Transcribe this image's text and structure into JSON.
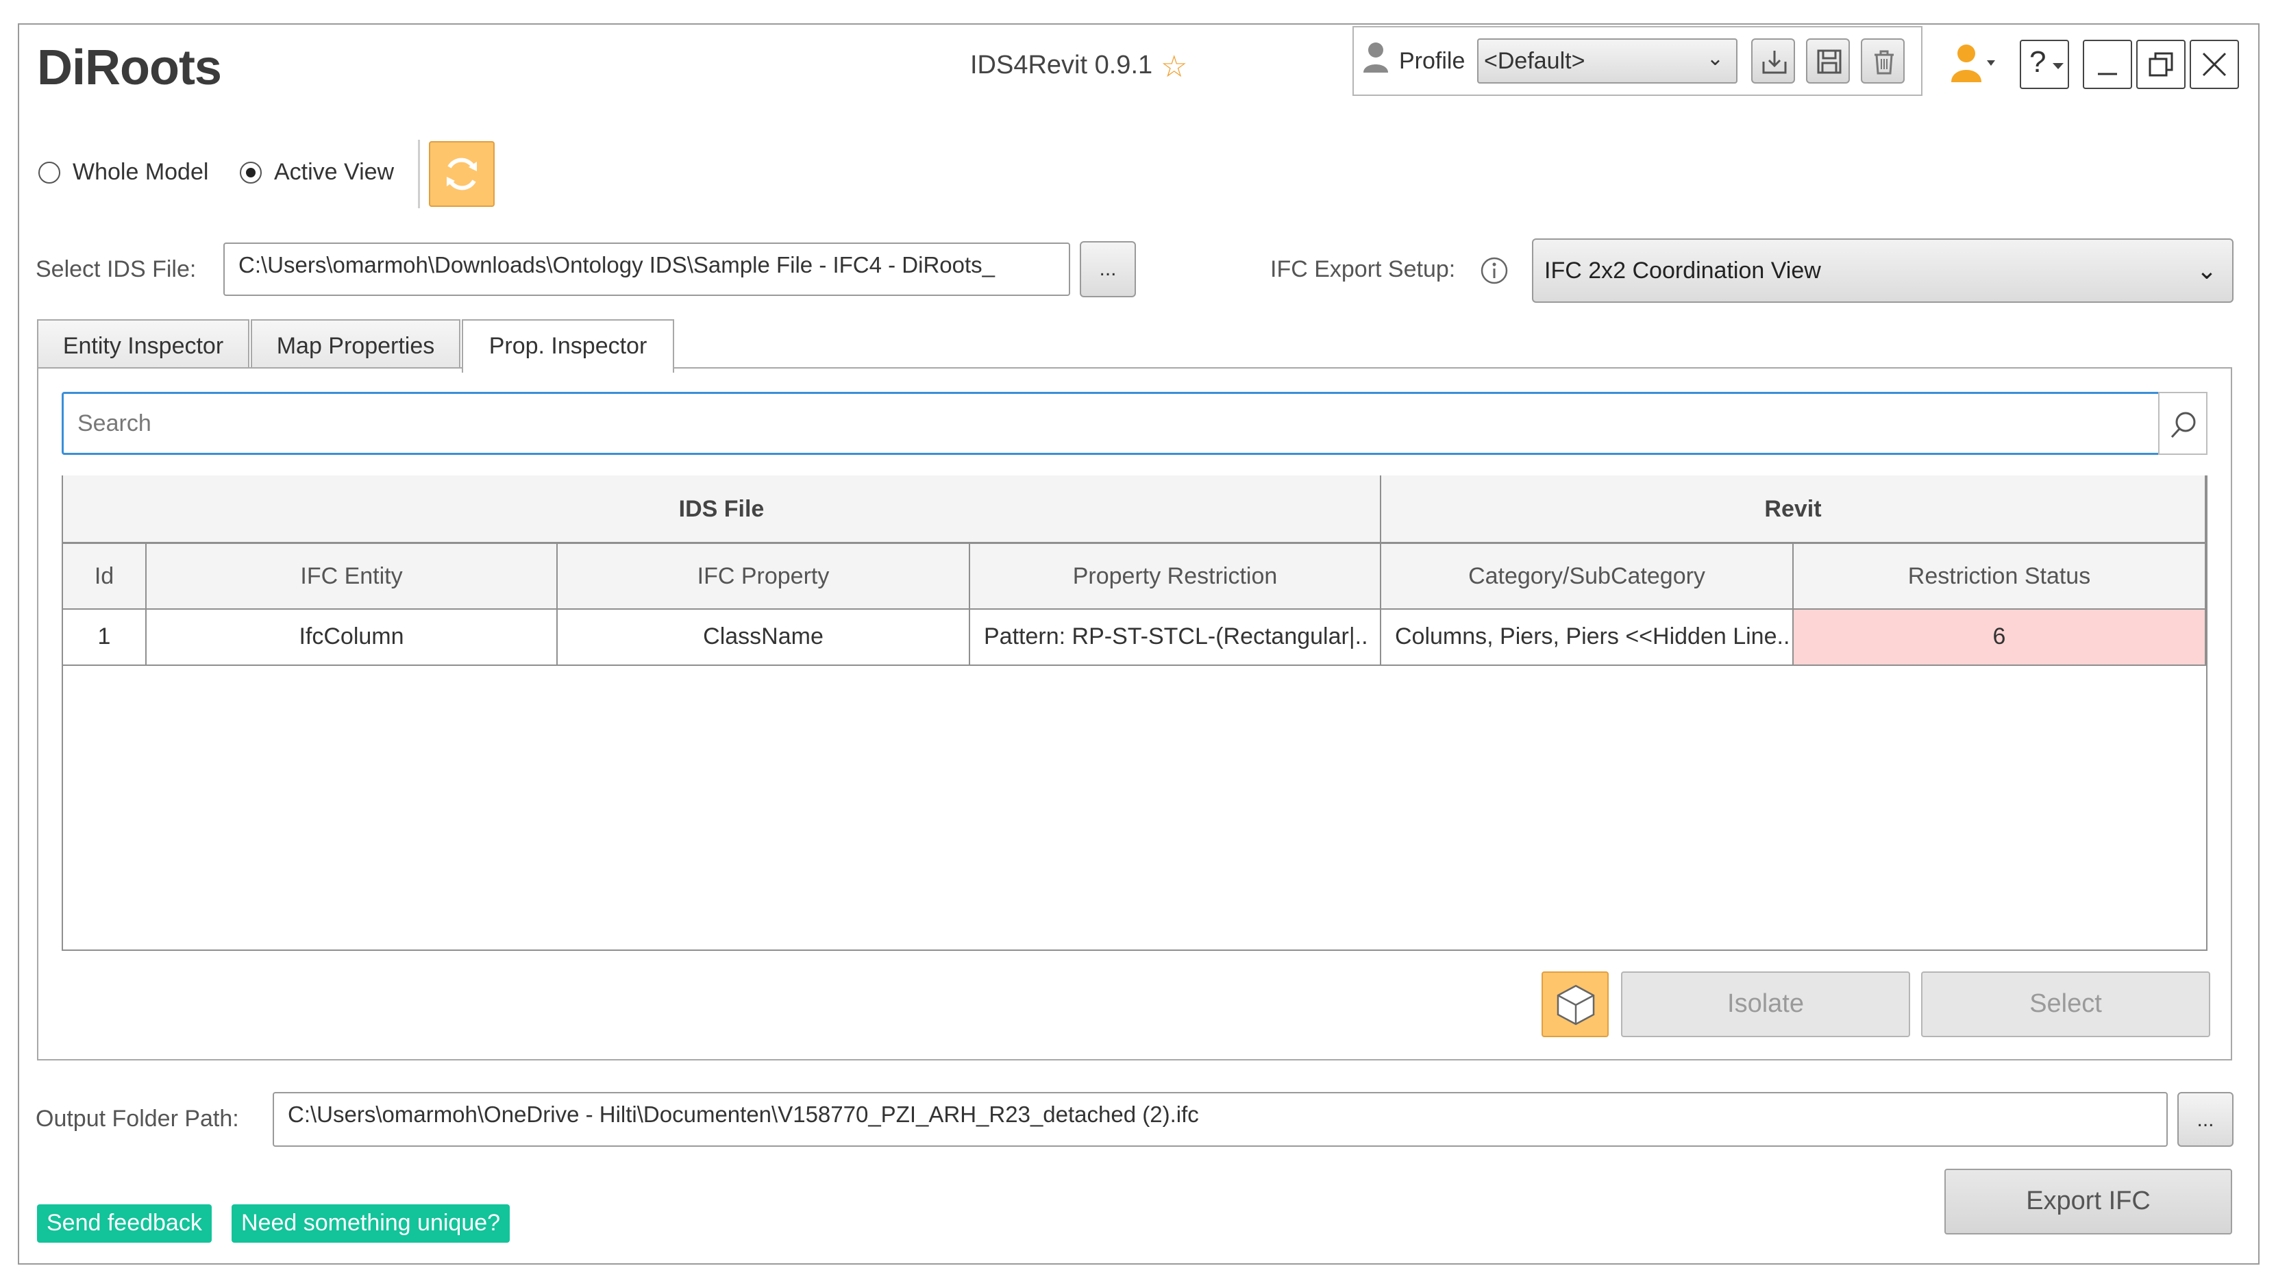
{
  "header": {
    "logo_text": "DiRoots",
    "app_title": "IDS4Revit 0.9.1",
    "profile_label": "Profile",
    "profile_value": "<Default>",
    "help_label": "?"
  },
  "scope": {
    "whole_model_label": "Whole Model",
    "active_view_label": "Active View",
    "selected": "Active View"
  },
  "ids_file": {
    "label": "Select IDS File:",
    "value": "C:\\Users\\omarmoh\\Downloads\\Ontology IDS\\Sample File - IFC4 - DiRoots_",
    "browse_label": "..."
  },
  "ifc_export": {
    "label": "IFC Export Setup:",
    "value": "IFC 2x2 Coordination View"
  },
  "tabs": [
    {
      "label": "Entity Inspector",
      "active": false
    },
    {
      "label": "Map Properties",
      "active": false
    },
    {
      "label": "Prop. Inspector",
      "active": true
    }
  ],
  "search": {
    "placeholder": "Search"
  },
  "table": {
    "groups": [
      "IDS File",
      "Revit"
    ],
    "columns": [
      "Id",
      "IFC Entity",
      "IFC Property",
      "Property Restriction",
      "Category/SubCategory",
      "Restriction Status"
    ],
    "rows": [
      [
        "1",
        "IfcColumn",
        "ClassName",
        "Pattern: RP-ST-STCL-(Rectangular|..",
        "Columns, Piers, Piers <<Hidden Line..",
        "6"
      ]
    ]
  },
  "actions": {
    "isolate_label": "Isolate",
    "select_label": "Select"
  },
  "output": {
    "label": "Output Folder Path:",
    "value": "C:\\Users\\omarmoh\\OneDrive - Hilti\\Documenten\\V158770_PZI_ARH_R23_detached (2).ifc",
    "browse_label": "..."
  },
  "footer": {
    "feedback_label": "Send feedback",
    "unique_label": "Need something unique?",
    "export_label": "Export IFC"
  },
  "colors": {
    "accent_orange": "#ffc56b",
    "status_red": "#fdd5d5",
    "feedback_green": "#13c39a",
    "search_focus": "#3a8fd8"
  }
}
